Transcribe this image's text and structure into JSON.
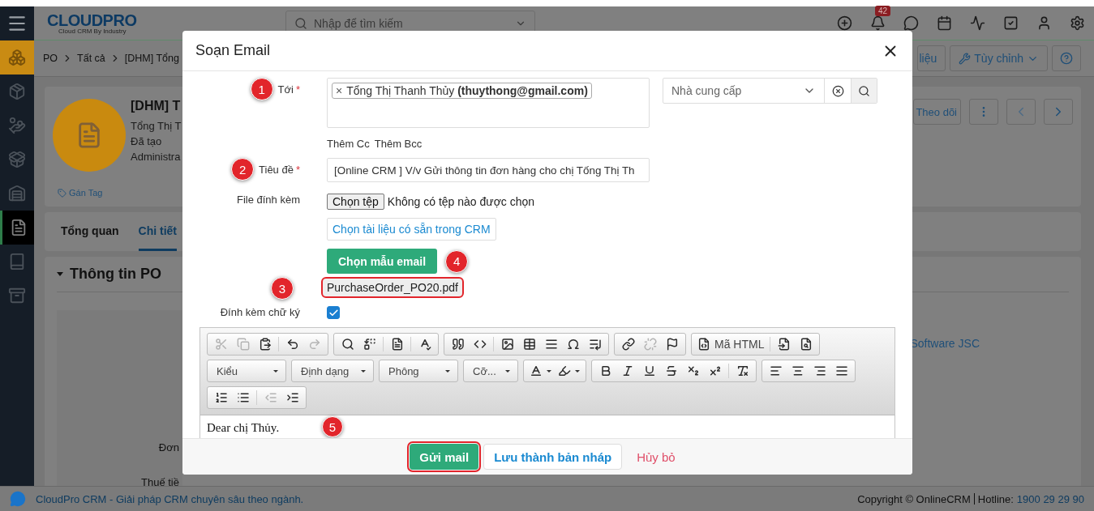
{
  "header": {
    "logo": "CLOUDPRO",
    "logo_tagline": "Cloud CRM By Industry",
    "search_placeholder": "Nhập để tìm kiếm",
    "notification_count": "42"
  },
  "sidebar": {
    "items": [
      {
        "accent": true,
        "selected": false
      },
      {
        "accent": false,
        "selected": false
      },
      {
        "accent": false,
        "selected": false
      },
      {
        "accent": false,
        "selected": false
      },
      {
        "accent": false,
        "selected": false
      },
      {
        "accent": false,
        "selected": true
      },
      {
        "accent": false,
        "selected": false
      },
      {
        "accent": false,
        "selected": false
      }
    ]
  },
  "breadcrumb": {
    "items": [
      "PO",
      "Tất cả",
      "[DHM] Tổng"
    ],
    "actions": [
      "liệu",
      "Tùy chỉnh"
    ]
  },
  "record": {
    "title": "[DHM] T",
    "lines": [
      "Tổng Thị T",
      "Đã tạo",
      "Administra"
    ],
    "tag": "Gán Tag",
    "follow": "Theo dõi"
  },
  "tabs": [
    {
      "label": "Tổng quan",
      "selected": false
    },
    {
      "label": "Chi tiết",
      "selected": true
    }
  ],
  "section": {
    "title": "Thông tin PO",
    "labels": [
      "Đơn",
      "Thuế tiề"
    ],
    "value": "Software JSC"
  },
  "footer": {
    "text": "CloudPro CRM - Giải pháp CRM chuyên sâu theo ngành.",
    "copyright": "Copyright © OnlineCRM",
    "hotline_label": "Hotline:",
    "hotline": "1900 29 29 90"
  },
  "modal": {
    "title": "Soạn Email",
    "to": {
      "label": "Tới",
      "required_mark": "*",
      "marker": "1",
      "recipients": [
        {
          "remove": "×",
          "text": "Tổng Thị Thanh Thủy **(thuythong@gmail.com)**"
        }
      ],
      "lookup_placeholder": "Nhà cung cấp"
    },
    "cc_links": [
      "Thêm Cc",
      "Thêm Bcc"
    ],
    "subject": {
      "label": "Tiêu đề",
      "required_mark": "*",
      "marker": "2",
      "value": "[Online CRM ] V/v Gửi thông tin đơn hàng cho chị Tống Thị Th"
    },
    "attachments": {
      "label": "File đính kèm",
      "file_button": "Chọn tệp",
      "file_status": "Không có tệp nào được chọn",
      "crm_button": "Chọn tài liệu có sẵn trong CRM",
      "template_button": "Chọn mẫu email",
      "template_marker": "4",
      "files": [
        {
          "name": "PurchaseOrder_PO20.pdf",
          "marker": "3",
          "highlighted": true
        }
      ]
    },
    "signature": {
      "label": "Đính kèm chữ ký",
      "checked": true
    },
    "editor": {
      "marker": "5",
      "body": "Dear chị Thủy.",
      "toolbar": [
        [
          {
            "items": [
              {
                "kind": "button",
                "disabled": true
              },
              {
                "kind": "button",
                "disabled": true
              },
              {
                "kind": "button",
                "disabled": false
              },
              {
                "kind": "separator"
              },
              {
                "kind": "button",
                "disabled": false
              },
              {
                "kind": "button",
                "disabled": true
              }
            ]
          },
          {
            "items": [
              {
                "kind": "button",
                "disabled": false
              },
              {
                "kind": "button",
                "disabled": false
              },
              {
                "kind": "separator"
              },
              {
                "kind": "button",
                "disabled": false
              },
              {
                "kind": "separator"
              },
              {
                "kind": "button",
                "disabled": false
              }
            ]
          },
          {
            "items": [
              {
                "kind": "button",
                "disabled": false
              },
              {
                "kind": "button",
                "disabled": false
              },
              {
                "kind": "separator"
              },
              {
                "kind": "button",
                "disabled": false
              },
              {
                "kind": "button",
                "disabled": false
              },
              {
                "kind": "button",
                "disabled": false
              },
              {
                "kind": "button",
                "disabled": false
              },
              {
                "kind": "button",
                "disabled": false
              }
            ]
          },
          {
            "items": [
              {
                "kind": "button",
                "disabled": false
              },
              {
                "kind": "button",
                "disabled": true
              },
              {
                "kind": "button",
                "disabled": false
              }
            ]
          },
          {
            "items": [
              {
                "kind": "labeled",
                "label": "Mã HTML",
                "disabled": false
              },
              {
                "kind": "separator"
              },
              {
                "kind": "button",
                "disabled": false
              },
              {
                "kind": "button",
                "disabled": false
              }
            ]
          }
        ],
        [
          {
            "items": [
              {
                "kind": "dropdown",
                "label": "Kiểu"
              }
            ]
          },
          {
            "items": [
              {
                "kind": "dropdown",
                "label": "Định dạng"
              }
            ]
          },
          {
            "items": [
              {
                "kind": "dropdown",
                "label": "Phông"
              }
            ]
          },
          {
            "items": [
              {
                "kind": "dropdown",
                "label": "Cỡ..."
              }
            ]
          },
          {
            "items": [
              {
                "kind": "color",
                "disabled": false
              },
              {
                "kind": "color",
                "disabled": false
              }
            ]
          },
          {
            "items": [
              {
                "kind": "button",
                "disabled": false
              },
              {
                "kind": "button",
                "disabled": false
              },
              {
                "kind": "button",
                "disabled": false
              },
              {
                "kind": "button",
                "disabled": false
              },
              {
                "kind": "button",
                "disabled": false
              },
              {
                "kind": "button",
                "disabled": false
              },
              {
                "kind": "separator"
              },
              {
                "kind": "button",
                "disabled": false
              }
            ]
          },
          {
            "items": [
              {
                "kind": "button",
                "disabled": false
              },
              {
                "kind": "button",
                "disabled": false
              },
              {
                "kind": "button",
                "disabled": false
              },
              {
                "kind": "button",
                "disabled": false
              }
            ]
          }
        ],
        [
          {
            "items": [
              {
                "kind": "button",
                "disabled": false
              },
              {
                "kind": "button",
                "disabled": false
              },
              {
                "kind": "separator"
              },
              {
                "kind": "button",
                "disabled": true
              },
              {
                "kind": "button",
                "disabled": false
              }
            ]
          }
        ]
      ]
    },
    "buttons": [
      {
        "label": "Gửi mail",
        "kind": "primary",
        "highlighted": true
      },
      {
        "label": "Lưu thành bản nháp",
        "kind": "secondary",
        "highlighted": false
      },
      {
        "label": "Hủy bỏ",
        "kind": "cancel",
        "highlighted": false
      }
    ]
  }
}
